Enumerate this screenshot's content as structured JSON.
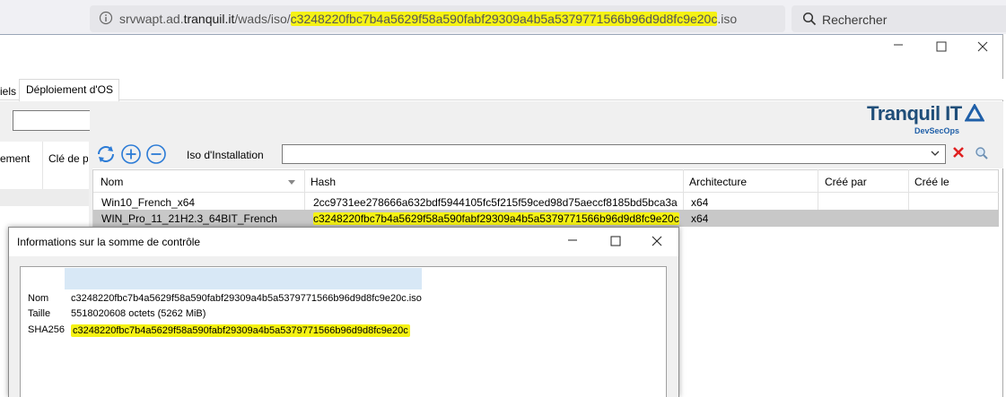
{
  "browser": {
    "url_prefix": "srvwapt.ad.",
    "url_host": "tranquil.it",
    "url_path": "/wads/iso/",
    "url_hash": "c3248220fbc7b4a5629f58a590fabf29309a4b5a5379771566b96d9d8fc9e20c",
    "url_ext": ".iso",
    "search_label": "Rechercher"
  },
  "window": {
    "tabs": [
      "iels",
      "Déploiement d'OS"
    ],
    "left": {
      "col1": "ement",
      "col2": "Clé de p"
    },
    "logo": {
      "word": "Tranquil IT",
      "sub": "DevSecOps"
    },
    "toolbar": {
      "iso_label": "Iso d'Installation"
    },
    "grid": {
      "columns": [
        "Nom",
        "Hash",
        "Architecture",
        "Créé par",
        "Créé le"
      ],
      "rows": [
        {
          "name": "Win10_French_x64",
          "hash": "2cc9731ee278666a632bdf5944105fc5f215f59ced98d75aeccf8185bd5bca3a",
          "arch": "x64",
          "created_by": "",
          "created_on": ""
        },
        {
          "name": "WIN_Pro_11_21H2.3_64BIT_French",
          "hash": "c3248220fbc7b4a5629f58a590fabf29309a4b5a5379771566b96d9d8fc9e20c",
          "arch": "x64",
          "created_by": "",
          "created_on": ""
        }
      ]
    }
  },
  "dialog": {
    "title": "Informations sur la somme de contrôle",
    "fields": {
      "name_label": "Nom",
      "name_value": "c3248220fbc7b4a5629f58a590fabf29309a4b5a5379771566b96d9d8fc9e20c.iso",
      "size_label": "Taille",
      "size_value": "5518020608 octets (5262 MiB)",
      "sha_label": "SHA256",
      "sha_value": "c3248220fbc7b4a5629f58a590fabf29309a4b5a5379771566b96d9d8fc9e20c"
    }
  },
  "colors": {
    "highlight": "#f5f214",
    "selected_row": "#c8c8c8",
    "accent_blue": "#1f5fa8",
    "clear_red": "#e02020"
  },
  "icons": [
    "info-icon",
    "search-icon",
    "minimize-icon",
    "maximize-icon",
    "close-icon",
    "refresh-icon",
    "add-icon",
    "remove-icon",
    "dropdown-arrow-icon",
    "clear-icon",
    "find-icon",
    "sort-arrow-icon",
    "logo-triangle-icon"
  ]
}
